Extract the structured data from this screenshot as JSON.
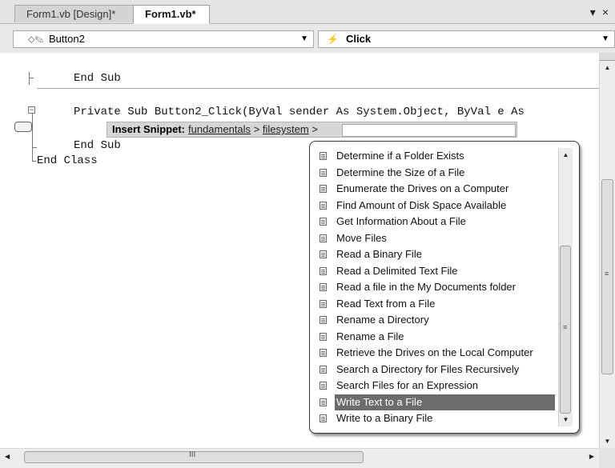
{
  "tabs": [
    {
      "label": "Form1.vb [Design]*",
      "active": false
    },
    {
      "label": "Form1.vb*",
      "active": true
    }
  ],
  "tab_tools": {
    "dropdown_glyph": "▾",
    "close_glyph": "×"
  },
  "combos": {
    "object": {
      "value": "Button2",
      "icon": "control-icon"
    },
    "event": {
      "value": "Click",
      "icon": "event-lightning-icon"
    }
  },
  "code": {
    "line_end_sub_1": "End Sub",
    "line_signature": "Private Sub Button2_Click(ByVal sender As System.Object, ByVal e As",
    "line_end_sub_2": "End Sub",
    "line_end_class": "End Class"
  },
  "snippet_bar": {
    "label": "Insert Snippet:",
    "crumb_1": "fundamentals",
    "sep_1": ">",
    "crumb_2": "filesystem",
    "sep_2": ">"
  },
  "snippet_list": {
    "items": [
      "Determine if a Folder Exists",
      "Determine the Size of a File",
      "Enumerate the Drives on a Computer",
      "Find Amount of Disk Space Available",
      "Get Information About a File",
      "Move Files",
      "Read a Binary File",
      "Read a Delimited Text File",
      "Read a file in the My Documents folder",
      "Read Text from a File",
      "Rename a Directory",
      "Rename a File",
      "Retrieve the Drives on the Local Computer",
      "Search a Directory for Files Recursively",
      "Search Files for an Expression",
      "Write Text to a File",
      "Write to a Binary File"
    ],
    "selected_index": 15,
    "item_icon": "snippet-document-icon"
  },
  "scrollbars": {
    "thumb_grip": "≡",
    "h_thumb_grip": "III"
  },
  "colors": {
    "selection": "#6c6c6c",
    "tab_strip": "#e4e4e4",
    "snippet_bar": "#d6d6d6"
  }
}
